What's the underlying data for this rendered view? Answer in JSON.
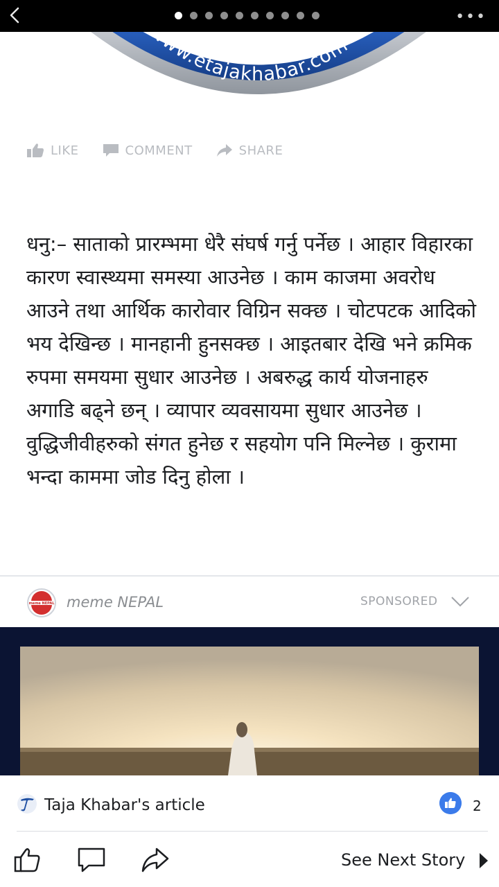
{
  "topbar": {
    "back_icon": "chevron-left-icon",
    "page_count": 10,
    "active_page": 1,
    "more_label": "•••"
  },
  "banner": {
    "url_text": "www.etajakhabar.com"
  },
  "actions": {
    "like": "LIKE",
    "comment": "COMMENT",
    "share": "SHARE"
  },
  "article": {
    "body": "धनु:– साताको प्रारम्भमा धेरै संघर्ष गर्नु पर्नेछ । आहार विहारका कारण स्वास्थ्यमा समस्या आउनेछ । काम काजमा अवरोध आउने तथा आर्थिक कारोवार विग्रिन सक्छ । चोटपटक आदिको भय देखिन्छ । मानहानी हुनसक्छ । आइतबार देखि भने क्रमिक रुपमा समयमा सुधार आउनेछ । अबरुद्ध कार्य योजनाहरु अगाडि बढ्ने छन् । व्यापार व्यवसायमा सुधार आउनेछ । वुद्धिजीवीहरुको संगत हुनेछ र सहयोग पनि मिल्नेछ । कुरामा भन्दा काममा जोड दिनु होला ।"
  },
  "sponsored": {
    "page_name": "meme NEPAL",
    "logo_text": "meme NEPAL",
    "label": "SPONSORED"
  },
  "footer": {
    "source_text": "Taja Khabar's article",
    "like_count": "2",
    "next_story": "See Next Story"
  },
  "colors": {
    "like_blue": "#3b7bea",
    "banner_blue": "#1d4ea2",
    "video_bg": "#0b1433"
  }
}
